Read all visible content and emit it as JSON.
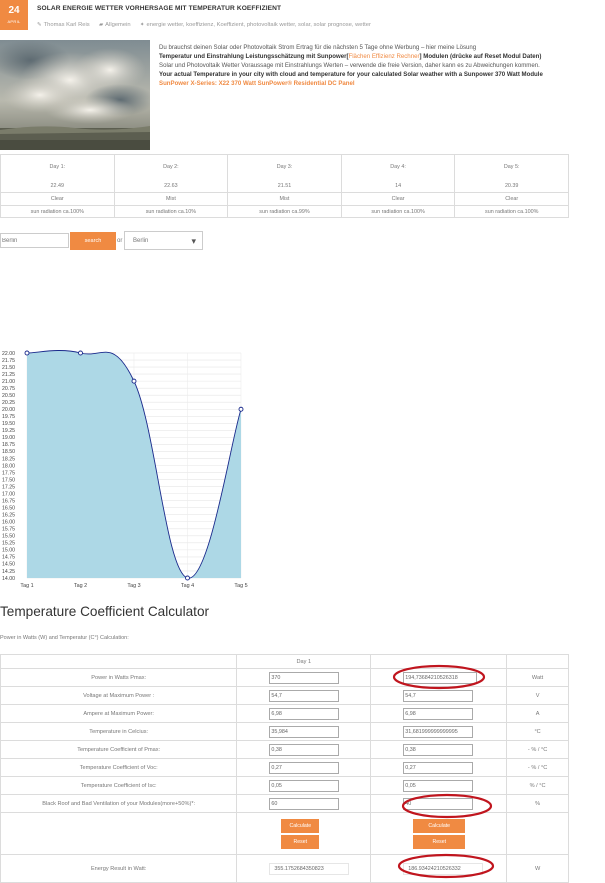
{
  "post": {
    "date_day": "24",
    "date_month": "APRIL",
    "title": "SOLAR ENERGIE WETTER VORHERSAGE MIT TEMPERATUR KOEFFIZIENT",
    "author": "Thomas Karl Reis",
    "category": "Allgemein",
    "tags": "energie wetter, koeffizienz, Koeffizient, photovoltaik wetter, solar, solar prognose, wetter",
    "intro_line1": "Du brauchst deinen Solar oder Photovoltaik Strom Ertrag für die nächsten 5 Tage ohne Werbung – hier meine Lösung",
    "intro_bold_a": "Temperatur und Einstrahlung Leistungsschätzung mit Sunpower[",
    "intro_link_a": "Flächen Effizienz Rechner",
    "intro_bold_b": "] Modulen (drücke auf Reset Modul Daten)",
    "intro_line3": "Solar und Photovoltaik Wetter Voraussage mit Einstrahlungs Werten – verwende die freie Version, daher kann es zu Abweichungen kommen.",
    "intro_bold_c": "Your actual Temperature in your city with cloud and temperature for your calculated Solar weather with a Sunpower 370 Watt Module ",
    "intro_link_b": "SunPower X-Series: X22 370 Watt SunPower® Residential DC Panel"
  },
  "forecast": {
    "days": [
      {
        "label": "Day 1:",
        "temp": "22.49",
        "sky": "Clear",
        "sun": "sun radiation ca.100%"
      },
      {
        "label": "Day 2:",
        "temp": "22.63",
        "sky": "Mist",
        "sun": "sun radiation ca.10%"
      },
      {
        "label": "Day 3:",
        "temp": "21.51",
        "sky": "Mist",
        "sun": "sun radiation ca.99%"
      },
      {
        "label": "Day 4:",
        "temp": "14",
        "sky": "Clear",
        "sun": "sun radiation ca.100%"
      },
      {
        "label": "Day 5:",
        "temp": "20.39",
        "sky": "Clear",
        "sun": "sun radiation ca.100%"
      }
    ]
  },
  "search": {
    "city_value": "Berlin",
    "button_label": "search",
    "or_label": "or",
    "select_value": "Berlin"
  },
  "chart_data": {
    "type": "area",
    "categories": [
      "Tag 1",
      "Tag 2",
      "Tag 3",
      "Tag 4",
      "Tag 5"
    ],
    "values": [
      22.0,
      22.0,
      21.0,
      14.0,
      20.0
    ],
    "ylim": [
      14.0,
      22.0
    ],
    "ytick_step": 0.25,
    "grid": true,
    "fill_color": "#add8e6",
    "line_color": "#1a2a8c"
  },
  "calc": {
    "title": "Temperature Coefficient Calculator",
    "subtitle": "Power in Watts (W) and Temperatur (C°) Calculation:",
    "day_header": "Day 1",
    "rows": [
      {
        "label": "Power in Watts Pmax:",
        "a": "370",
        "b": "194,73684210526318",
        "unit": "Watt"
      },
      {
        "label": "Voltage at Maximum Power :",
        "a": "54,7",
        "b": "54,7",
        "unit": "V"
      },
      {
        "label": "Ampere at Maximum Power:",
        "a": "6,98",
        "b": "6,98",
        "unit": "A"
      },
      {
        "label": "Temperature in Celcius:",
        "a": "35,984",
        "b": "31,681999999999995",
        "unit": "°C"
      },
      {
        "label": "Temperature Coefficient of Pmax:",
        "a": "0,38",
        "b": "0,38",
        "unit": "- % / °C"
      },
      {
        "label": "Temperature Coefficient of Voc:",
        "a": "0,27",
        "b": "0,27",
        "unit": "- % / °C"
      },
      {
        "label": "Temperature Coefficient of Isc:",
        "a": "0,05",
        "b": "0,05",
        "unit": "% / °C"
      },
      {
        "label": "Black Roof and Bad Ventilation of your Modules(more+50%)*:",
        "a": "60",
        "b": "40",
        "unit": "%"
      }
    ],
    "calculate_label": "Calculate",
    "reset_label": "Reset",
    "energy_label": "Energy Result in Watt:",
    "energy_a": "355.1752684350823",
    "energy_b": "186.93424210526332",
    "energy_unit": "W",
    "highlight_color": "#c0151e",
    "accent_color": "#f08a42"
  }
}
